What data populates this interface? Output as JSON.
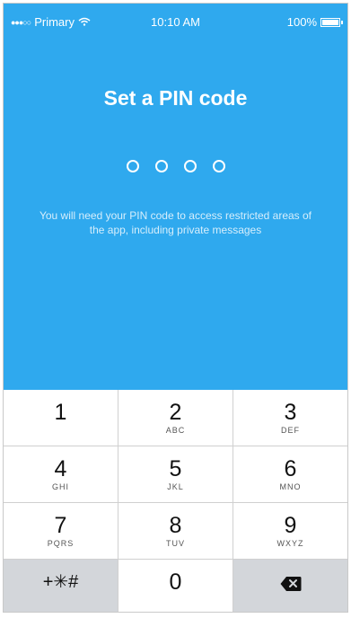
{
  "status_bar": {
    "carrier": "Primary",
    "time": "10:10 AM",
    "battery": "100%"
  },
  "screen": {
    "title": "Set a PIN code",
    "pin_length": 4,
    "description": "You will need your PIN code to access restricted areas of the app, including private messages"
  },
  "keypad": {
    "keys": [
      {
        "digit": "1",
        "letters": ""
      },
      {
        "digit": "2",
        "letters": "ABC"
      },
      {
        "digit": "3",
        "letters": "DEF"
      },
      {
        "digit": "4",
        "letters": "GHI"
      },
      {
        "digit": "5",
        "letters": "JKL"
      },
      {
        "digit": "6",
        "letters": "MNO"
      },
      {
        "digit": "7",
        "letters": "PQRS"
      },
      {
        "digit": "8",
        "letters": "TUV"
      },
      {
        "digit": "9",
        "letters": "WXYZ"
      }
    ],
    "symbols_label": "+✳#",
    "zero": "0",
    "delete_icon": "backspace-icon"
  },
  "colors": {
    "primary": "#2fa9ee",
    "key_bg": "#ffffff",
    "key_grey": "#d3d6da"
  }
}
